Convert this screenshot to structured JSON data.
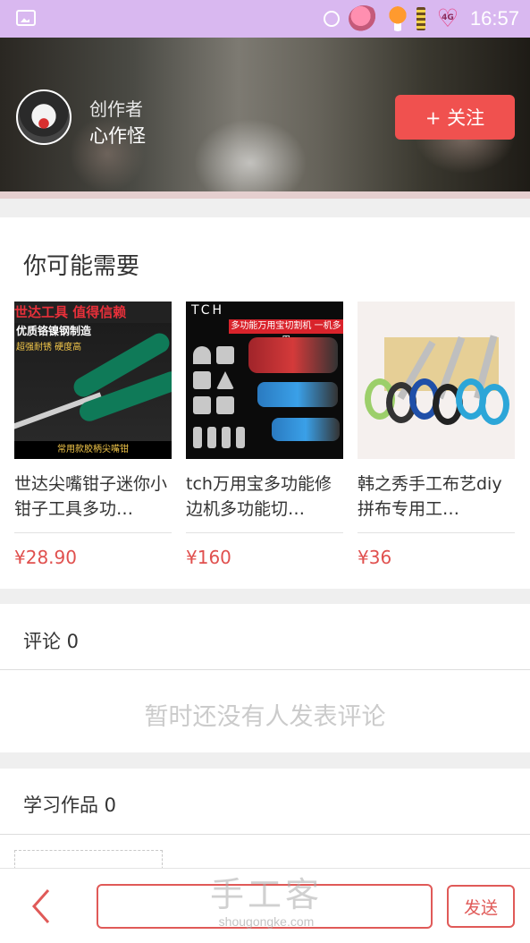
{
  "status_bar": {
    "time": "16:57",
    "badge": "4G",
    "icons": [
      "gallery-icon",
      "alarm-icon",
      "flower-icon",
      "mushroom-icon",
      "battery-icon",
      "heart-icon"
    ]
  },
  "creator": {
    "label": "创作者",
    "name": "心作怪",
    "follow_label": "+ 关注"
  },
  "recommend": {
    "title": "你可能需要",
    "products": [
      {
        "name": "世达尖嘴钳子迷你小钳子工具多功…",
        "price": "¥28.90",
        "image": {
          "band": "世达工具 值得信赖",
          "sub": "优质铬镍钢制造",
          "sub2": "超强耐锈 硬度高",
          "foot": "常用款胶柄尖嘴钳"
        }
      },
      {
        "name": "tch万用宝多功能修边机多功能切…",
        "price": "¥160",
        "image": {
          "brand": "TCH",
          "tag": "多功能万用宝切割机 一机多用"
        }
      },
      {
        "name": "韩之秀手工布艺diy拼布专用工…",
        "price": "¥36",
        "image": {}
      }
    ]
  },
  "comments": {
    "title": "评论 0",
    "empty": "暂时还没有人发表评论"
  },
  "works": {
    "title": "学习作品 0"
  },
  "bottom_bar": {
    "send_label": "发送",
    "input_value": ""
  },
  "watermark": {
    "main": "手工客",
    "sub": "shougongke.com"
  },
  "colors": {
    "accent": "#f0514f",
    "status_bar": "#d9b8f0",
    "price": "#e0504e"
  }
}
